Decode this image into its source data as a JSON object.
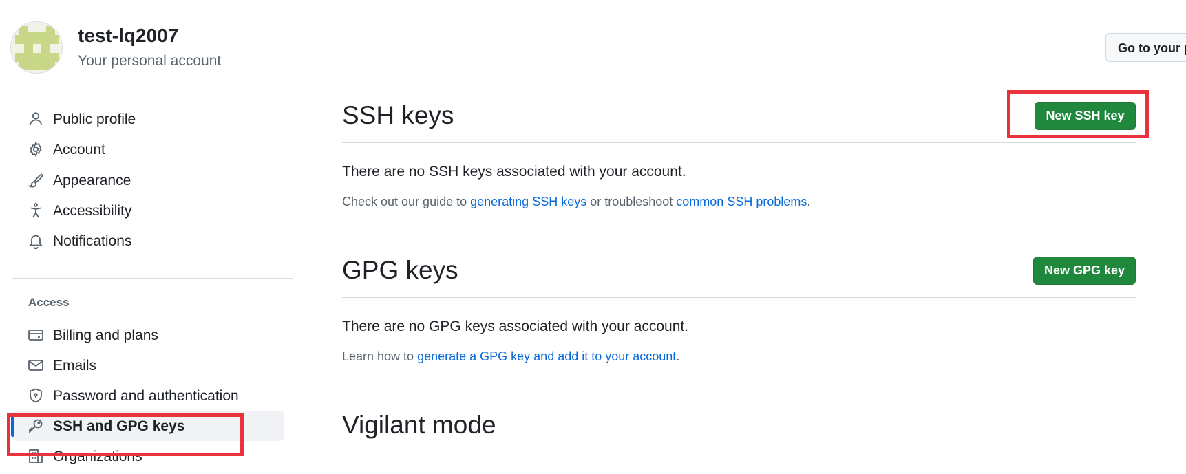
{
  "header": {
    "account_name": "test-lq2007",
    "account_subtitle": "Your personal account",
    "goto_button": "Go to your p"
  },
  "sidebar": {
    "items_top": [
      {
        "label": "Public profile",
        "icon": "person-icon"
      },
      {
        "label": "Account",
        "icon": "gear-icon"
      },
      {
        "label": "Appearance",
        "icon": "paintbrush-icon"
      },
      {
        "label": "Accessibility",
        "icon": "accessibility-icon"
      },
      {
        "label": "Notifications",
        "icon": "bell-icon"
      }
    ],
    "access_heading": "Access",
    "items_access": [
      {
        "label": "Billing and plans",
        "icon": "credit-card-icon"
      },
      {
        "label": "Emails",
        "icon": "mail-icon"
      },
      {
        "label": "Password and authentication",
        "icon": "shield-lock-icon"
      },
      {
        "label": "SSH and GPG keys",
        "icon": "key-icon",
        "active": true
      },
      {
        "label": "Organizations",
        "icon": "organization-icon"
      }
    ]
  },
  "main": {
    "ssh": {
      "title": "SSH keys",
      "button": "New SSH key",
      "empty": "There are no SSH keys associated with your account.",
      "help_prefix": "Check out our guide to ",
      "help_link1": "generating SSH keys",
      "help_middle": " or troubleshoot ",
      "help_link2": "common SSH problems",
      "help_suffix": "."
    },
    "gpg": {
      "title": "GPG keys",
      "button": "New GPG key",
      "empty": "There are no GPG keys associated with your account.",
      "help_prefix": "Learn how to ",
      "help_link": "generate a GPG key and add it to your account",
      "help_suffix": "."
    },
    "vigilant": {
      "title": "Vigilant mode"
    }
  },
  "colors": {
    "accent_green": "#1f883d",
    "link_blue": "#0969da",
    "active_indicator": "#0969da",
    "highlight_red": "#e8333d",
    "avatar_green": "#c5d88a"
  }
}
